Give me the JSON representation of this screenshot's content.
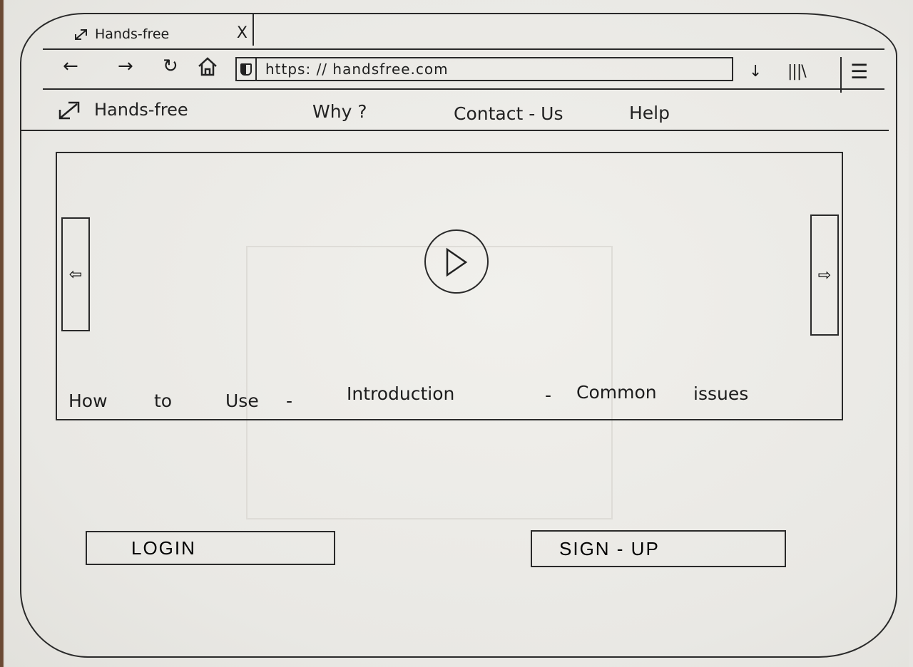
{
  "browser": {
    "tab": {
      "title": "Hands-free",
      "close_glyph": "X"
    },
    "nav": {
      "back": "←",
      "forward": "→",
      "reload": "↻",
      "home": "⌂"
    },
    "address_bar": {
      "url": "https: // handsfree.com"
    },
    "toolbar": {
      "download": "↓",
      "library": "|||\\",
      "menu": "☰"
    }
  },
  "site": {
    "logo_label": "Hands-free",
    "nav": {
      "why": "Why ?",
      "contact": "Contact - Us",
      "help": "Help"
    }
  },
  "hero": {
    "prev_glyph": "⇦",
    "next_glyph": "⇨",
    "caption": {
      "w1": "How",
      "w2": "to",
      "w3": "Use",
      "sep1": "-",
      "w4": "Introduction",
      "sep2": "-",
      "w5": "Common",
      "w6": "issues"
    }
  },
  "actions": {
    "login": "LOGIN",
    "signup": "SIGN - UP"
  },
  "icons": {
    "tab_icon": "external-link-icon",
    "logo_icon": "external-link-icon",
    "play_icon": "play-icon",
    "security_icon": "shield-icon"
  }
}
